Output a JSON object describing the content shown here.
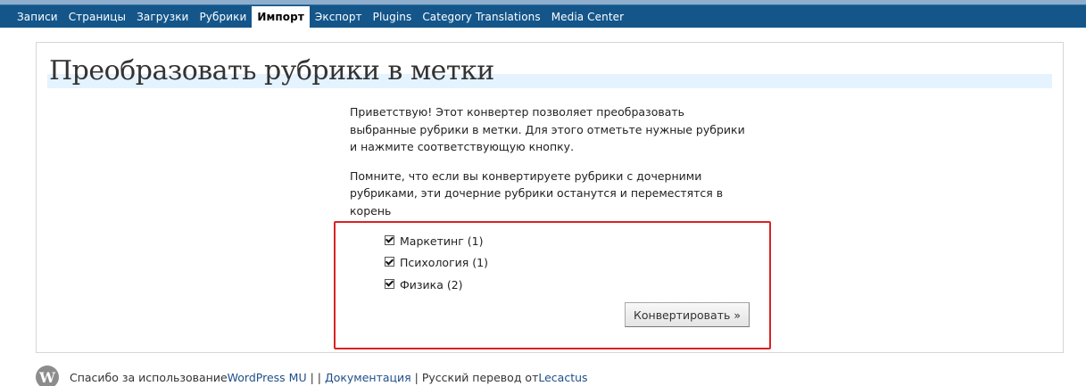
{
  "nav": {
    "items": [
      {
        "label": "Записи"
      },
      {
        "label": "Страницы"
      },
      {
        "label": "Загрузки"
      },
      {
        "label": "Рубрики"
      },
      {
        "label": "Импорт",
        "active": true
      },
      {
        "label": "Экспорт"
      },
      {
        "label": "Plugins"
      },
      {
        "label": "Category Translations"
      },
      {
        "label": "Media Center"
      }
    ]
  },
  "page": {
    "title": "Преобразовать рубрики в метки",
    "intro_1": "Приветствую! Этот конвертер позволяет преобразовать выбранные рубрики в метки. Для этого отметьте нужные рубрики и нажмите соответствующую кнопку.",
    "intro_2": "Помните, что если вы конвертируете рубрики с дочерними рубриками, эти дочерние рубрики останутся и переместятся в корень"
  },
  "categories": [
    {
      "label": "Маркетинг (1)",
      "checked": true
    },
    {
      "label": "Психология (1)",
      "checked": true
    },
    {
      "label": "Физика (2)",
      "checked": true
    }
  ],
  "convert_button": "Конвертировать »",
  "footer": {
    "thanks_text": "Спасибо за использование ",
    "wpmu_link": "WordPress MU",
    "sep1": " | | ",
    "docs_link": "Документация",
    "sep2": " | ",
    "translation_text": "Русский перевод от ",
    "translator_link": "Lecactus",
    "logo_letter": "W"
  },
  "colors": {
    "navbar": "#14568a",
    "title_band": "#e5f3ff",
    "highlight": "#d92323",
    "link": "#1f4f8a"
  }
}
